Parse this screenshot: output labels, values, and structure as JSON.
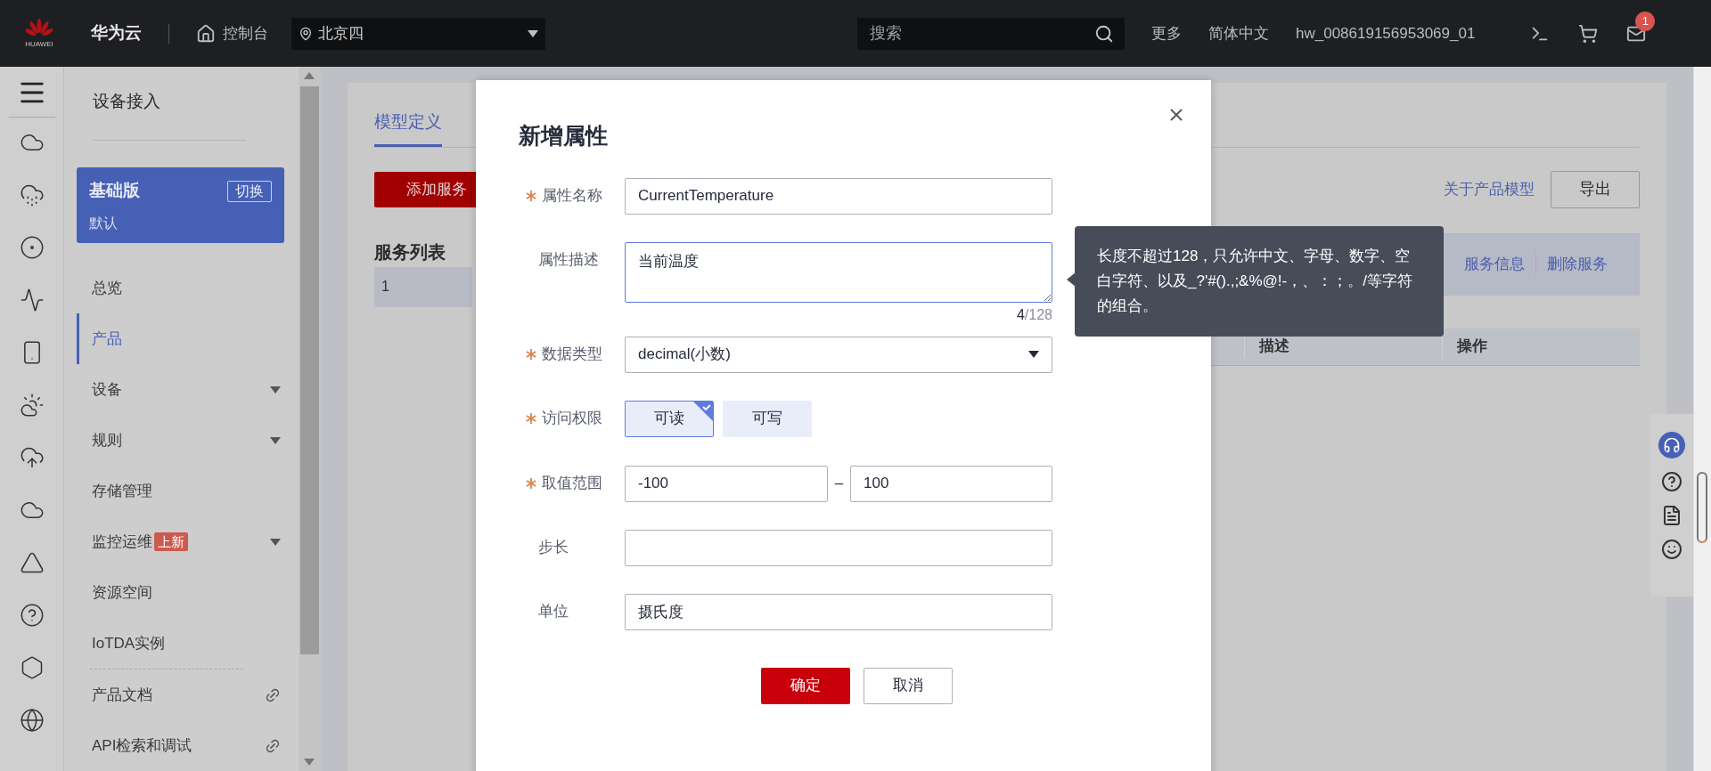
{
  "header": {
    "logo_text": "HUAWEI",
    "brand": "华为云",
    "console": "控制台",
    "region": "北京四",
    "search_placeholder": "搜索",
    "links": [
      "更多",
      "简体中文"
    ],
    "user": "hw_008619156953069_01",
    "mail_badge": "1"
  },
  "sidebar": {
    "title": "设备接入",
    "edition": {
      "name": "基础版",
      "switch": "切换",
      "sub": "默认"
    },
    "items": [
      {
        "label": "总览",
        "selected": false,
        "kind": "plain"
      },
      {
        "label": "产品",
        "selected": true,
        "kind": "plain"
      },
      {
        "label": "设备",
        "selected": false,
        "kind": "expandable"
      },
      {
        "label": "规则",
        "selected": false,
        "kind": "expandable"
      },
      {
        "label": "存储管理",
        "selected": false,
        "kind": "plain"
      },
      {
        "label": "监控运维",
        "selected": false,
        "kind": "expandable",
        "badge": "上新"
      },
      {
        "label": "资源空间",
        "selected": false,
        "kind": "plain"
      },
      {
        "label": "IoTDA实例",
        "selected": false,
        "kind": "plain"
      },
      {
        "label": "产品文档",
        "selected": false,
        "kind": "external"
      },
      {
        "label": "API检索和调试",
        "selected": false,
        "kind": "external"
      }
    ]
  },
  "main": {
    "tabs": [
      {
        "label": "模型定义",
        "selected": true
      }
    ],
    "add_button": "添加服务",
    "section_title": "服务列表",
    "row_number": "1",
    "about_link": "关于产品模型",
    "export_button": "导出",
    "actions": [
      "服务信息",
      "删除服务"
    ],
    "columns": [
      "描述",
      "操作"
    ]
  },
  "dialog": {
    "title": "新增属性",
    "fields": [
      {
        "kind": "text",
        "label": "属性名称",
        "required": true,
        "value": "CurrentTemperature"
      },
      {
        "kind": "textarea",
        "label": "属性描述",
        "required": false,
        "value": "当前温度",
        "focused": true,
        "counter_current": "4",
        "counter_max": "/128"
      },
      {
        "kind": "select",
        "label": "数据类型",
        "required": true,
        "value": "decimal(小数)"
      },
      {
        "kind": "toggle",
        "label": "访问权限",
        "required": true,
        "options": [
          {
            "label": "可读",
            "selected": true
          },
          {
            "label": "可写",
            "selected": false
          }
        ]
      },
      {
        "kind": "range",
        "label": "取值范围",
        "required": true,
        "min": "-100",
        "separator": "–",
        "max": "100"
      },
      {
        "kind": "text",
        "label": "步长",
        "required": false
      },
      {
        "kind": "text",
        "label": "单位",
        "required": false,
        "value": "摄氏度"
      }
    ],
    "buttons": [
      {
        "label": "确定",
        "kind": "primary"
      },
      {
        "label": "取消",
        "kind": "secondary"
      }
    ]
  },
  "tooltip": {
    "text": "长度不超过128，只允许中文、字母、数字、空白字符、以及_?'#().,;&%@!-，、：；。/等字符的组合。"
  }
}
